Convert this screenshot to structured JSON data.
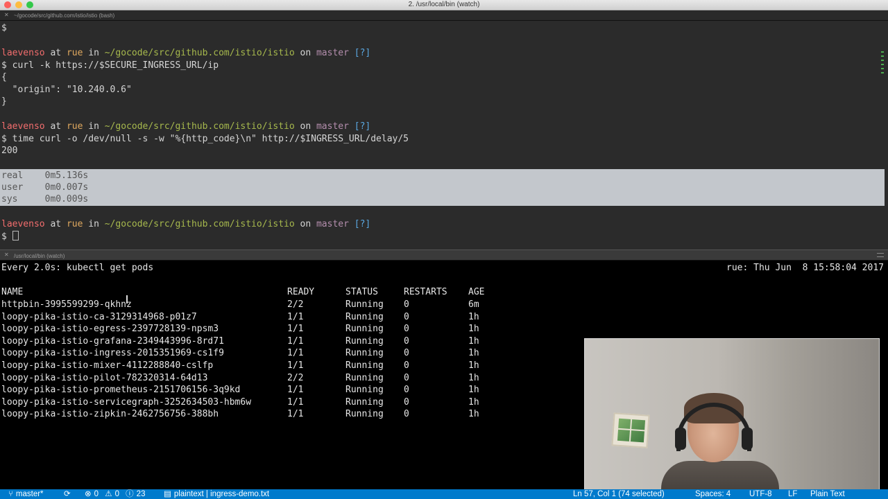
{
  "window": {
    "title": "2. /usr/local/bin (watch)",
    "tab_label": "~/gocode/src/github.com/istio/istio (bash)",
    "tab_close": "✕"
  },
  "top_pane": {
    "prompt_user": "laevenso",
    "prompt_at": " at ",
    "prompt_host": "rue",
    "prompt_in": " in ",
    "prompt_path": "~/gocode/src/github.com/istio/istio",
    "prompt_on": " on ",
    "prompt_branch": "master",
    "prompt_dirty": "[?]",
    "dollar": "$",
    "cmd1": "$ curl -k https://$SECURE_INGRESS_URL/ip",
    "out1_open": "{",
    "out1_body": "  \"origin\": \"10.240.0.6\"",
    "out1_close": "}",
    "cmd2": "$ time curl -o /dev/null -s -w \"%{http_code}\\n\" http://$INGRESS_URL/delay/5",
    "out2": "200",
    "time_real": "real    0m5.136s",
    "time_user": "user    0m0.007s",
    "time_sys": "sys     0m0.009s"
  },
  "split": {
    "label": "/usr/local/bin (watch)",
    "close": "✕"
  },
  "bottom_pane": {
    "watch_header": "Every 2.0s: kubectl get pods",
    "watch_right": "rue: Thu Jun  8 15:58:04 2017",
    "columns": {
      "name": "NAME",
      "ready": "READY",
      "status": "STATUS",
      "restarts": "RESTARTS",
      "age": "AGE"
    },
    "pods": [
      {
        "name": "httpbin-3995599299-qkhnz",
        "ready": "2/2",
        "status": "Running",
        "restarts": "0",
        "age": "6m"
      },
      {
        "name": "loopy-pika-istio-ca-3129314968-p01z7",
        "ready": "1/1",
        "status": "Running",
        "restarts": "0",
        "age": "1h"
      },
      {
        "name": "loopy-pika-istio-egress-2397728139-npsm3",
        "ready": "1/1",
        "status": "Running",
        "restarts": "0",
        "age": "1h"
      },
      {
        "name": "loopy-pika-istio-grafana-2349443996-8rd71",
        "ready": "1/1",
        "status": "Running",
        "restarts": "0",
        "age": "1h"
      },
      {
        "name": "loopy-pika-istio-ingress-2015351969-cs1f9",
        "ready": "1/1",
        "status": "Running",
        "restarts": "0",
        "age": "1h"
      },
      {
        "name": "loopy-pika-istio-mixer-4112288840-cslfp",
        "ready": "1/1",
        "status": "Running",
        "restarts": "0",
        "age": "1h"
      },
      {
        "name": "loopy-pika-istio-pilot-782320314-64d13",
        "ready": "2/2",
        "status": "Running",
        "restarts": "0",
        "age": "1h"
      },
      {
        "name": "loopy-pika-istio-prometheus-2151706156-3q9kd",
        "ready": "1/1",
        "status": "Running",
        "restarts": "0",
        "age": "1h"
      },
      {
        "name": "loopy-pika-istio-servicegraph-3252634503-hbm6w",
        "ready": "1/1",
        "status": "Running",
        "restarts": "0",
        "age": "1h"
      },
      {
        "name": "loopy-pika-istio-zipkin-2462756756-388bh",
        "ready": "1/1",
        "status": "Running",
        "restarts": "0",
        "age": "1h"
      }
    ]
  },
  "statusbar": {
    "branch": "master*",
    "errors": "0",
    "warnings": "0",
    "info": "23",
    "language": "plaintext",
    "separator": "|",
    "file": "ingress-demo.txt",
    "position": "Ln 57, Col 1 (74 selected)",
    "spaces": "Spaces: 4",
    "encoding": "UTF-8",
    "eol": "LF",
    "mode": "Plain Text",
    "color_bg": "#007acc"
  }
}
